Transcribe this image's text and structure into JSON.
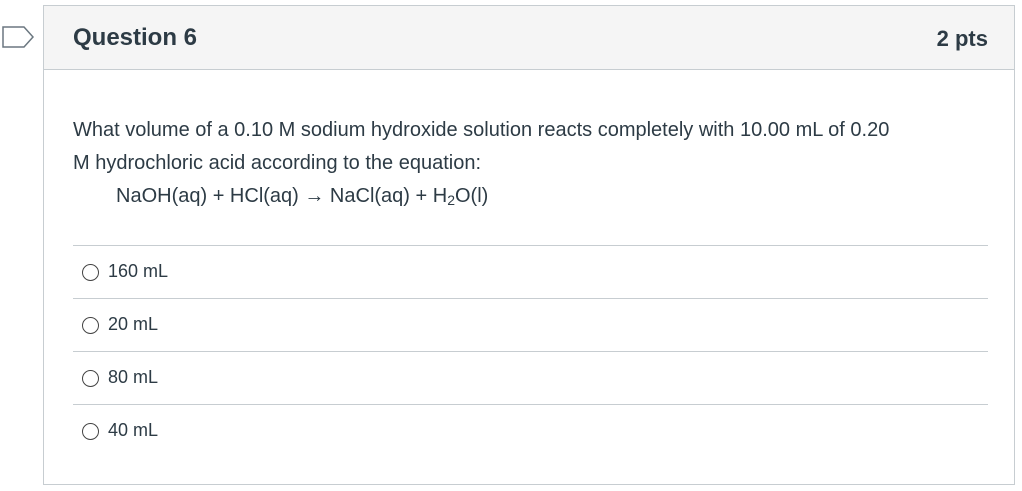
{
  "question": {
    "title": "Question 6",
    "points": "2 pts",
    "text_line1": "What volume of a 0.10 M sodium hydroxide solution reacts completely with 10.00 mL of 0.20",
    "text_line2": "M hydrochloric acid according to the equation:",
    "equation_main": "NaOH(aq) + HCl(aq) → NaCl(aq) + H",
    "equation_sub": "2",
    "equation_end": "O(l)",
    "flag_icon": "bookmark-flag-icon"
  },
  "answers": [
    {
      "label": "160 mL",
      "selected": false
    },
    {
      "label": "20 mL",
      "selected": false
    },
    {
      "label": "80 mL",
      "selected": false
    },
    {
      "label": "40 mL",
      "selected": false
    }
  ],
  "colors": {
    "text": "#2d3b45",
    "border": "#c7cdd1",
    "header_bg": "#f5f5f5"
  }
}
